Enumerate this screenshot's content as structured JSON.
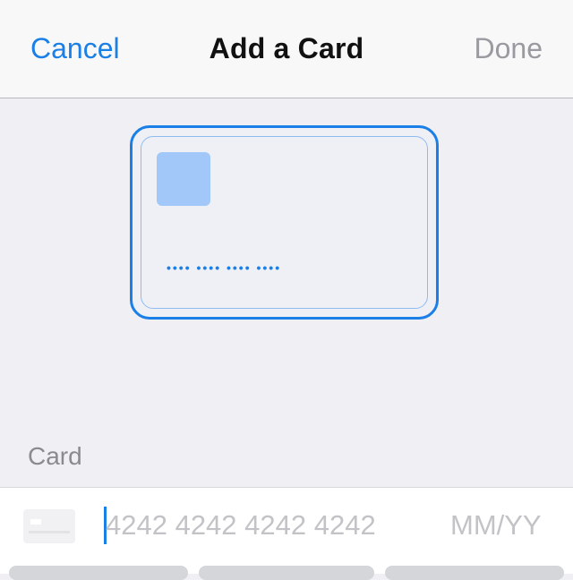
{
  "nav": {
    "cancel_label": "Cancel",
    "title": "Add a Card",
    "done_label": "Done"
  },
  "card_preview": {
    "masked_number": "•••• •••• •••• ••••"
  },
  "section": {
    "label": "Card"
  },
  "card_form": {
    "number_placeholder": "4242 4242 4242 4242",
    "expiry_placeholder": "MM/YY"
  },
  "colors": {
    "accent": "#1a7fe6",
    "disabled": "#9a9aa0",
    "background": "#efeff4"
  }
}
